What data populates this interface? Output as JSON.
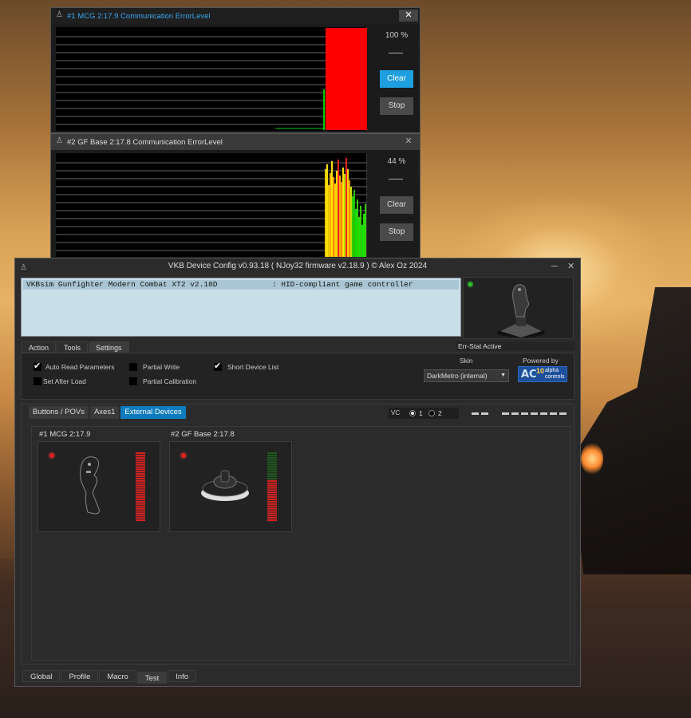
{
  "windows": {
    "err1": {
      "title": "#1 MCG  2:17.9  Communication ErrorLevel",
      "percent": "100 %",
      "clear_label": "Clear",
      "stop_label": "Stop",
      "close_label": "✕"
    },
    "err2": {
      "title": "#2 GF Base  2:17.8  Communication ErrorLevel",
      "percent": "44 %",
      "clear_label": "Clear",
      "stop_label": "Stop",
      "close_label": "✕"
    }
  },
  "main": {
    "title": "VKB Device Config v0.93.18 ( NJoy32 firmware v2.18.9 ) © Alex Oz 2024",
    "minimize_label": "─",
    "close_label": "✕",
    "device_row": "VKBsim Gunfighter Modern Combat XT2 v2.18D            : HID-compliant game controller",
    "tabs": [
      "Action",
      "Tools",
      "Settings"
    ],
    "err_stat": "Err-Stat Active",
    "settings": {
      "auto_read": "Auto Read Parameters",
      "set_after_load": "Set After Load",
      "partial_write": "Partial Write",
      "partial_calibration": "Partial Calibration",
      "short_device_list": "Short Device List",
      "skin_label": "Skin",
      "skin_value": "DarkMetro (internal)",
      "powered_by": "Powered by",
      "logo_num": "10",
      "logo_text1": "alpha",
      "logo_text2": "controls",
      "logo_mark": "AC"
    },
    "test_tabs": [
      "Buttons / POVs",
      "Axes1",
      "External Devices"
    ],
    "vc_label": "VC",
    "vc_opt1": "1",
    "vc_opt2": "2",
    "devices": [
      {
        "title": "#1 MCG 2:17.9",
        "level": 1.0
      },
      {
        "title": "#2 GF Base 2:17.8",
        "level": 0.6
      }
    ],
    "bottom_tabs": [
      "Global",
      "Profile",
      "Macro",
      "Test",
      "Info"
    ]
  },
  "colors": {
    "accent": "#1e9fe0",
    "tab_active": "#0d7bbf",
    "error_red": "#ff0000",
    "ok_green": "#00cc00",
    "warn_yellow": "#ffe000"
  }
}
